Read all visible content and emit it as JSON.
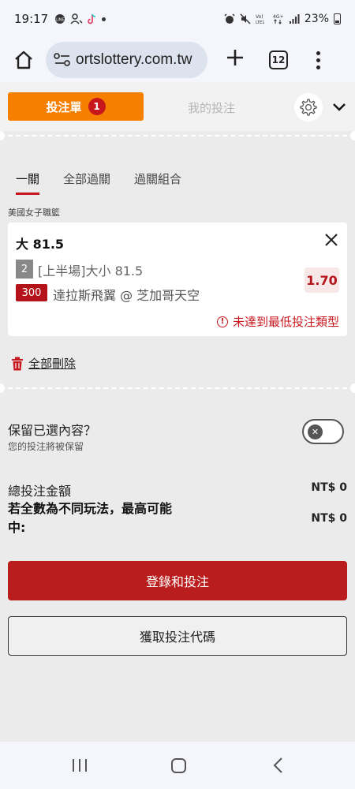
{
  "status_bar": {
    "time": "19:17",
    "battery": "23%",
    "network": "4G+"
  },
  "browser": {
    "url": "ortslottery.com.tw",
    "tab_count": "12"
  },
  "header": {
    "betslip_label": "投注單",
    "betslip_count": "1",
    "my_bets_label": "我的投注"
  },
  "bet_types": {
    "tabs": [
      {
        "label": "一關"
      },
      {
        "label": "全部過關"
      },
      {
        "label": "過關組合"
      }
    ],
    "active_index": 0
  },
  "league": "美國女子職籃",
  "selection": {
    "title": "大 81.5",
    "market_num": "2",
    "market": "[上半場]大小 81.5",
    "match_code": "300",
    "match": "達拉斯飛翼 @ 芝加哥天空",
    "odds": "1.70",
    "warning": "未達到最低投注類型"
  },
  "actions": {
    "delete_all": "全部刪除",
    "login_bet": "登錄和投注",
    "get_code": "獲取投注代碼"
  },
  "retain": {
    "title": "保留已選內容？",
    "subtitle": "您的投注將被保留",
    "enabled": false
  },
  "totals": {
    "total_label": "總投注金額",
    "total_value": "NT$ 0",
    "max_win_label": "若全數為不同玩法，最高可能中:",
    "max_win_value": "NT$ 0"
  }
}
